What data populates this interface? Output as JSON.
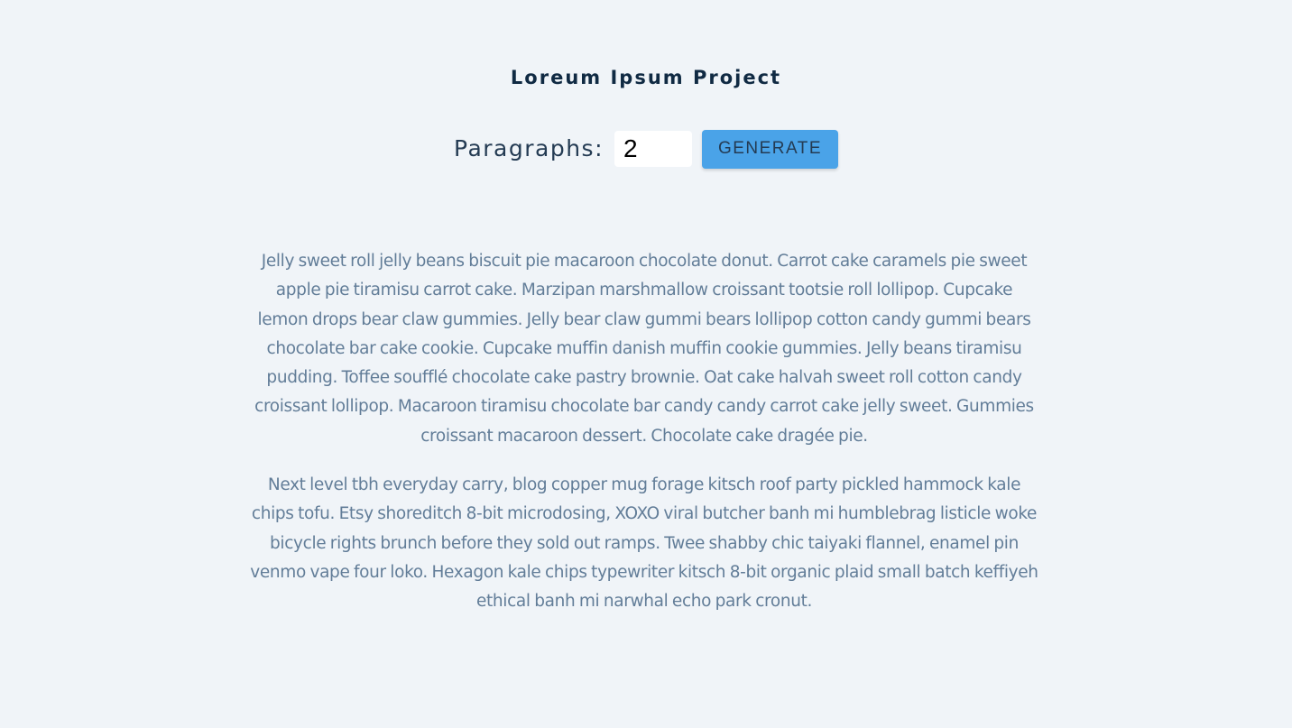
{
  "header": {
    "title": "Loreum Ipsum Project"
  },
  "form": {
    "label": "Paragraphs:",
    "amount_value": "2",
    "generate_label": "Generate"
  },
  "paragraphs": [
    "Jelly sweet roll jelly beans biscuit pie macaroon chocolate donut. Carrot cake caramels pie sweet apple pie tiramisu carrot cake. Marzipan marshmallow croissant tootsie roll lollipop. Cupcake lemon drops bear claw gummies. Jelly bear claw gummi bears lollipop cotton candy gummi bears chocolate bar cake cookie. Cupcake muffin danish muffin cookie gummies. Jelly beans tiramisu pudding. Toffee soufflé chocolate cake pastry brownie. Oat cake halvah sweet roll cotton candy croissant lollipop. Macaroon tiramisu chocolate bar candy candy carrot cake jelly sweet. Gummies croissant macaroon dessert. Chocolate cake dragée pie.",
    "Next level tbh everyday carry, blog copper mug forage kitsch roof party pickled hammock kale chips tofu. Etsy shoreditch 8-bit microdosing, XOXO viral butcher banh mi humblebrag listicle woke bicycle rights brunch before they sold out ramps. Twee shabby chic taiyaki flannel, enamel pin venmo vape four loko. Hexagon kale chips typewriter kitsch 8-bit organic plaid small batch keffiyeh ethical banh mi narwhal echo park cronut."
  ],
  "colors": {
    "background": "#f0f4f8",
    "title": "#102a43",
    "button": "#4aa3e8",
    "paragraph_text": "#627d98"
  }
}
